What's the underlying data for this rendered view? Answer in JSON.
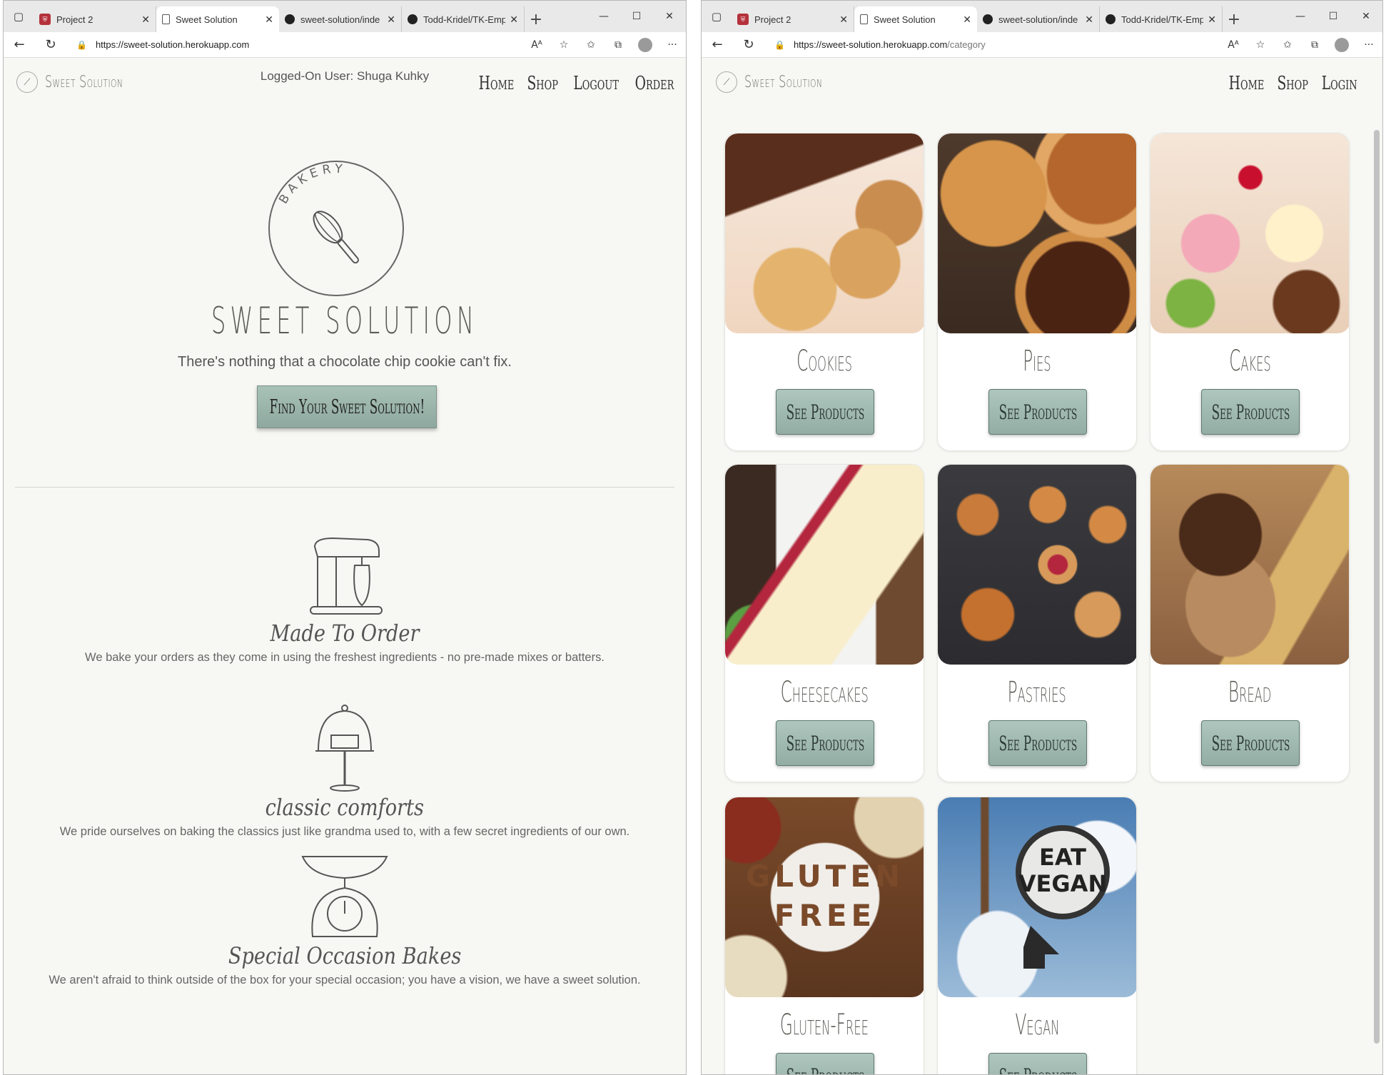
{
  "left_window": {
    "tabs": [
      {
        "label": "Project 2",
        "favicon": "project-icon"
      },
      {
        "label": "Sweet Solution",
        "favicon": "page-icon",
        "active": true
      },
      {
        "label": "sweet-solution/inde",
        "favicon": "github-icon"
      },
      {
        "label": "Todd-Kridel/TK-Emp",
        "favicon": "github-icon"
      }
    ],
    "url_host": "https://sweet-solution.herokuapp.com",
    "url_path": "",
    "page": {
      "user_line": "Logged-On User: Shuga Kuhky",
      "brand": "Sweet Solution",
      "nav": [
        "Home",
        "Shop",
        "Logout",
        "Order"
      ],
      "emblem_text": "BAKERY",
      "hero_title": "SWEET SOLUTION",
      "tagline": "There's nothing that a chocolate chip cookie can't fix.",
      "cta": "Find Your Sweet Solution!",
      "features": [
        {
          "title": "Made To Order",
          "desc": "We bake your orders as they come in using the freshest ingredients - no pre-made mixes or batters.",
          "icon": "stand-mixer-icon"
        },
        {
          "title": "classic comforts",
          "desc": "We pride ourselves on baking the classics just like grandma used to, with a few secret ingredients of our own.",
          "icon": "cake-dome-icon"
        },
        {
          "title": "Special Occasion Bakes",
          "desc": "We aren't afraid to think outside of the box for your special occasion; you have a vision, we have a sweet solution.",
          "icon": "kitchen-scale-icon"
        }
      ]
    }
  },
  "right_window": {
    "tabs": [
      {
        "label": "Project 2",
        "favicon": "project-icon"
      },
      {
        "label": "Sweet Solution",
        "favicon": "page-icon",
        "active": true
      },
      {
        "label": "sweet-solution/inde",
        "favicon": "github-icon"
      },
      {
        "label": "Todd-Kridel/TK-Emp",
        "favicon": "github-icon"
      }
    ],
    "url_host": "https://sweet-solution.herokuapp.com",
    "url_path": "/category",
    "page": {
      "brand": "Sweet Solution",
      "nav": [
        "Home",
        "Shop",
        "Login"
      ],
      "categories": [
        {
          "name": "Cookies",
          "button": "See Products",
          "image": "cookies-photo"
        },
        {
          "name": "Pies",
          "button": "See Products",
          "image": "pies-photo"
        },
        {
          "name": "Cakes",
          "button": "See Products",
          "image": "cakes-photo"
        },
        {
          "name": "Cheesecakes",
          "button": "See Products",
          "image": "cheesecakes-photo"
        },
        {
          "name": "Pastries",
          "button": "See Products",
          "image": "pastries-photo"
        },
        {
          "name": "Bread",
          "button": "See Products",
          "image": "bread-photo"
        },
        {
          "name": "Gluten-Free",
          "button": "See Products",
          "image": "gluten-free-photo",
          "image_text": "GLUTEN FREE"
        },
        {
          "name": "Vegan",
          "button": "See Products",
          "image": "vegan-photo",
          "image_text": "EAT VEGAN"
        }
      ]
    }
  },
  "colors": {
    "page_bg": "#f7f7f3",
    "button_green": "#9bb5ab",
    "text_gray": "#5c5c58"
  }
}
